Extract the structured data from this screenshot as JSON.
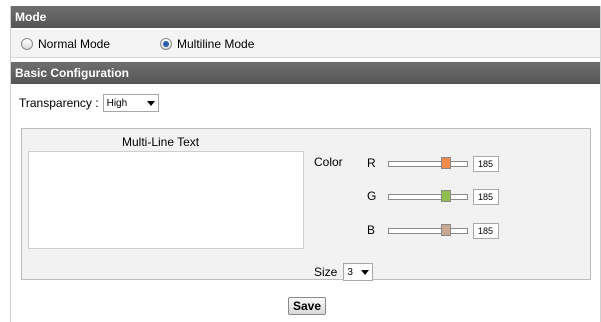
{
  "mode": {
    "title": "Mode",
    "options": [
      {
        "label": "Normal Mode",
        "checked": false
      },
      {
        "label": "Multiline Mode",
        "checked": true
      }
    ]
  },
  "basic": {
    "title": "Basic Configuration",
    "transparency_label": "Transparency :",
    "transparency_value": "High",
    "multiline_label": "Multi-Line Text",
    "multiline_value": "",
    "color_label": "Color",
    "channels": [
      {
        "label": "R",
        "value": "185",
        "fraction": 0.73,
        "thumb_color": "#f28a4a"
      },
      {
        "label": "G",
        "value": "185",
        "fraction": 0.73,
        "thumb_color": "#8fbf4a"
      },
      {
        "label": "B",
        "value": "185",
        "fraction": 0.73,
        "thumb_color": "#c8a890"
      }
    ],
    "size_label": "Size",
    "size_value": "3"
  },
  "save_label": "Save"
}
